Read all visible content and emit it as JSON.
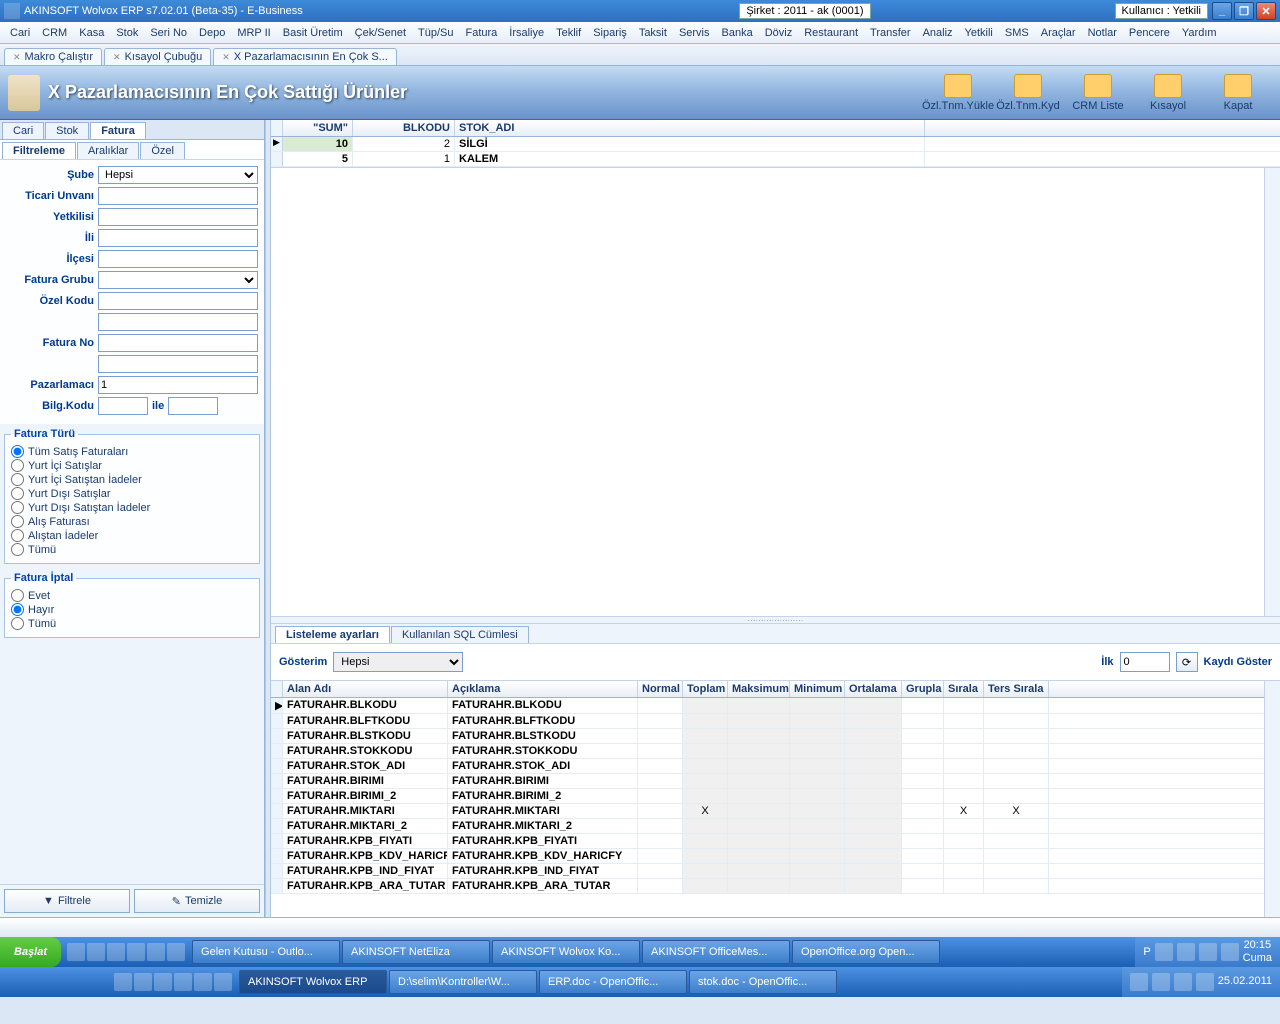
{
  "title": {
    "app": "AKINSOFT Wolvox ERP s7.02.01 (Beta-35) - E-Business",
    "company": "Şirket : 2011 - ak (0001)",
    "user": "Kullanıcı : Yetkili"
  },
  "menu": [
    "Cari",
    "CRM",
    "Kasa",
    "Stok",
    "Seri No",
    "Depo",
    "MRP II",
    "Basit Üretim",
    "Çek/Senet",
    "Tüp/Su",
    "Fatura",
    "İrsaliye",
    "Teklif",
    "Sipariş",
    "Taksit",
    "Servis",
    "Banka",
    "Döviz",
    "Restaurant",
    "Transfer",
    "Analiz",
    "Yetkili",
    "SMS",
    "Araçlar",
    "Notlar",
    "Pencere",
    "Yardım"
  ],
  "doctabs": [
    "Makro Çalıştır",
    "Kısayol Çubuğu",
    "X Pazarlamacısının En Çok S..."
  ],
  "page_title": "X Pazarlamacısının En Çok Sattığı Ürünler",
  "toolbar": [
    {
      "l": "Özl.Tnm.Yükle"
    },
    {
      "l": "Özl.Tnm.Kyd"
    },
    {
      "l": "CRM Liste"
    },
    {
      "l": "Kısayol"
    },
    {
      "l": "Kapat"
    }
  ],
  "ltabs": [
    "Cari",
    "Stok",
    "Fatura"
  ],
  "subtabs": [
    "Filtreleme",
    "Aralıklar",
    "Özel"
  ],
  "filter": {
    "sube": {
      "label": "Şube",
      "value": "Hepsi"
    },
    "ticari": {
      "label": "Ticari Unvanı"
    },
    "yetkilisi": {
      "label": "Yetkilisi"
    },
    "ili": {
      "label": "İli"
    },
    "ilcesi": {
      "label": "İlçesi"
    },
    "fgrubu": {
      "label": "Fatura Grubu"
    },
    "ozelkodu": {
      "label": "Özel Kodu"
    },
    "faturano": {
      "label": "Fatura No"
    },
    "pazarlamaci": {
      "label": "Pazarlamacı",
      "value": "1"
    },
    "bilgkodu": {
      "label": "Bilg.Kodu",
      "ile": "ile"
    }
  },
  "fatura_turu": {
    "legend": "Fatura Türü",
    "opts": [
      "Tüm Satış Faturaları",
      "Yurt İçi Satışlar",
      "Yurt İçi Satıştan İadeler",
      "Yurt Dışı Satışlar",
      "Yurt Dışı Satıştan İadeler",
      "Alış Faturası",
      "Alıştan İadeler",
      "Tümü"
    ],
    "sel": 0
  },
  "fatura_iptal": {
    "legend": "Fatura İptal",
    "opts": [
      "Evet",
      "Hayır",
      "Tümü"
    ],
    "sel": 1
  },
  "btn_filter": "Filtrele",
  "btn_clear": "Temizle",
  "data_cols": [
    "\"SUM\"",
    "BLKODU",
    "STOK_ADI"
  ],
  "data_rows": [
    {
      "sum": "10",
      "bl": "2",
      "ad": "SİLGİ",
      "sel": true
    },
    {
      "sum": "5",
      "bl": "1",
      "ad": "KALEM"
    }
  ],
  "bottabs": [
    "Listeleme ayarları",
    "Kullanılan SQL Cümlesi"
  ],
  "gosterim": {
    "label": "Gösterim",
    "value": "Hepsi"
  },
  "ilk": {
    "label": "İlk",
    "value": "0",
    "btn": "Kaydı Göster"
  },
  "grid_cols": [
    "Alan Adı",
    "Açıklama",
    "Normal",
    "Toplam",
    "Maksimum",
    "Minimum",
    "Ortalama",
    "Grupla",
    "Sırala",
    "Ters Sırala"
  ],
  "grid_rows": [
    {
      "a": "FATURAHR.BLKODU",
      "b": "FATURAHR.BLKODU",
      "m": true
    },
    {
      "a": "FATURAHR.BLFTKODU",
      "b": "FATURAHR.BLFTKODU"
    },
    {
      "a": "FATURAHR.BLSTKODU",
      "b": "FATURAHR.BLSTKODU"
    },
    {
      "a": "FATURAHR.STOKKODU",
      "b": "FATURAHR.STOKKODU"
    },
    {
      "a": "FATURAHR.STOK_ADI",
      "b": "FATURAHR.STOK_ADI"
    },
    {
      "a": "FATURAHR.BIRIMI",
      "b": "FATURAHR.BIRIMI"
    },
    {
      "a": "FATURAHR.BIRIMI_2",
      "b": "FATURAHR.BIRIMI_2"
    },
    {
      "a": "FATURAHR.MIKTARI",
      "b": "FATURAHR.MIKTARI",
      "toplam": "X",
      "sirala": "X",
      "ters": "X"
    },
    {
      "a": "FATURAHR.MIKTARI_2",
      "b": "FATURAHR.MIKTARI_2"
    },
    {
      "a": "FATURAHR.KPB_FIYATI",
      "b": "FATURAHR.KPB_FIYATI"
    },
    {
      "a": "FATURAHR.KPB_KDV_HARICFY",
      "b": "FATURAHR.KPB_KDV_HARICFY"
    },
    {
      "a": "FATURAHR.KPB_IND_FIYAT",
      "b": "FATURAHR.KPB_IND_FIYAT"
    },
    {
      "a": "FATURAHR.KPB_ARA_TUTAR",
      "b": "FATURAHR.KPB_ARA_TUTAR"
    }
  ],
  "taskbar": {
    "start": "Başlat",
    "tasks": [
      "Gelen Kutusu - Outlo...",
      "AKINSOFT NetEliza",
      "AKINSOFT Wolvox Ko...",
      "AKINSOFT OfficeMes...",
      "OpenOffice.org Open..."
    ],
    "tasks2": [
      "AKINSOFT Wolvox ERP",
      "D:\\selim\\Kontroller\\W...",
      "ERP.doc - OpenOffic...",
      "stok.doc - OpenOffic..."
    ],
    "clock": {
      "time": "20:15",
      "day": "Cuma",
      "date": "25.02.2011"
    },
    "p": "P"
  }
}
